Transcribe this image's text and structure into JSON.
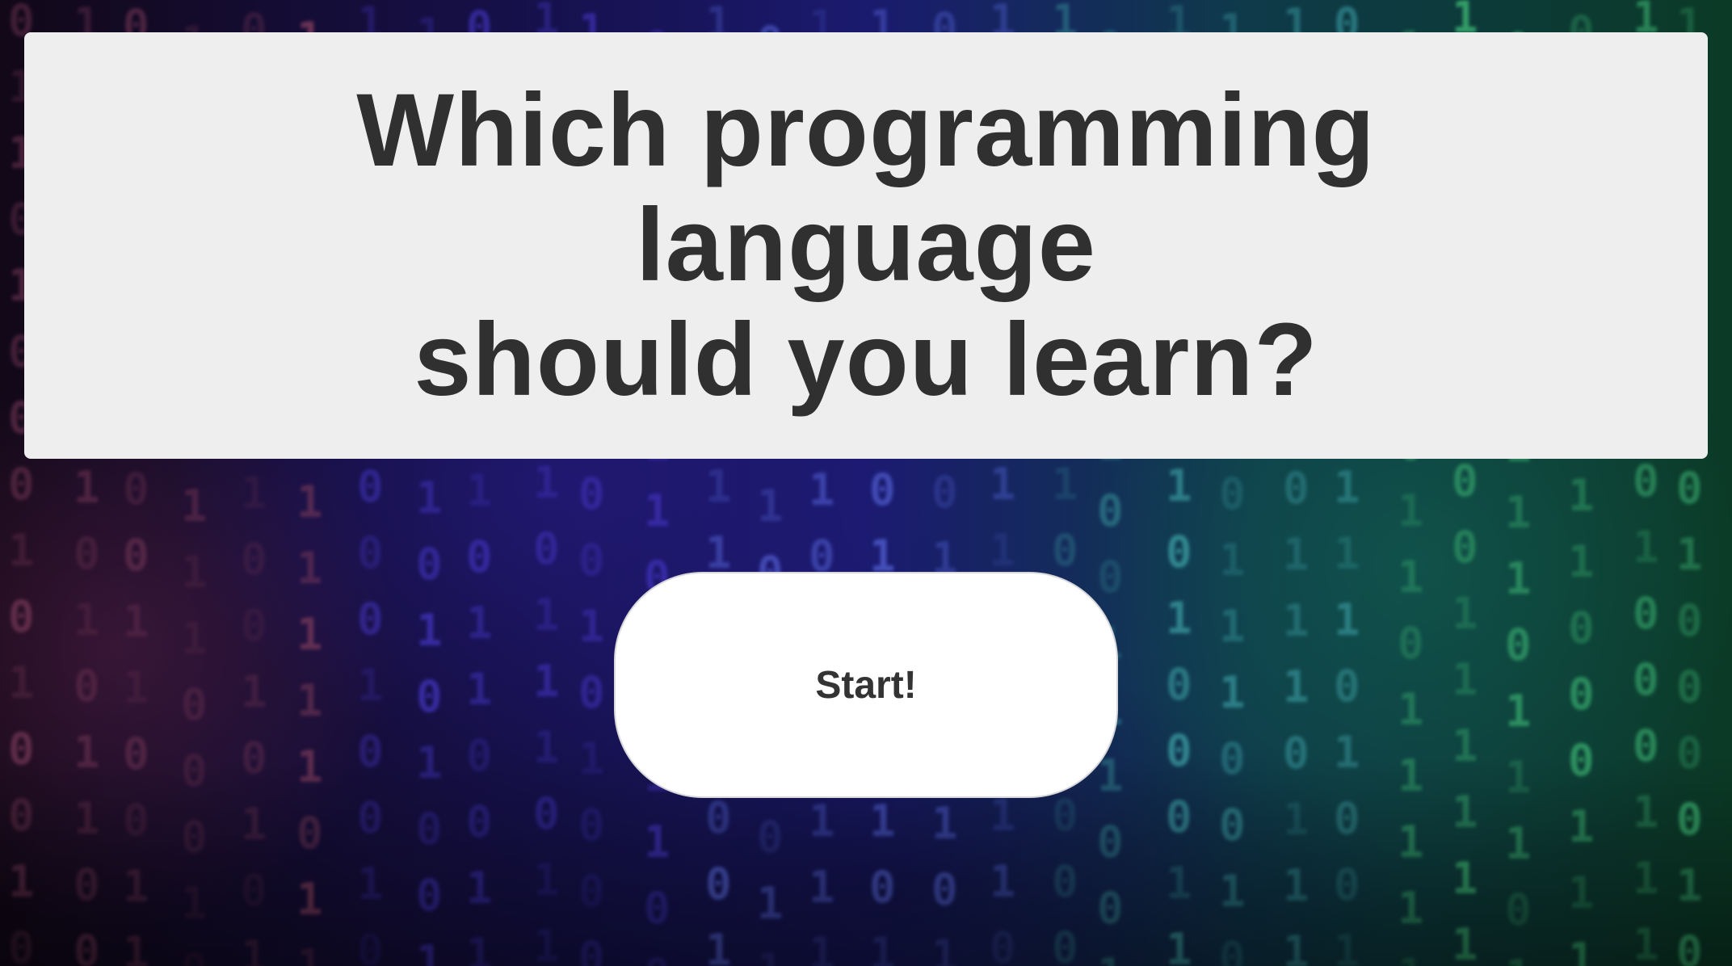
{
  "title": {
    "line1": "Which programming language",
    "line2": "should you learn?"
  },
  "start_button": {
    "label": "Start!"
  },
  "background": {
    "pattern": "binary-digit-rain",
    "colors": [
      "#7a3a5a",
      "#4a3ad0",
      "#5a6ae0",
      "#3a9aa0",
      "#3ab070"
    ]
  },
  "colors": {
    "card": "#eeeeef",
    "title_text": "#303030",
    "button": "#ffffff",
    "button_text": "#333333"
  }
}
